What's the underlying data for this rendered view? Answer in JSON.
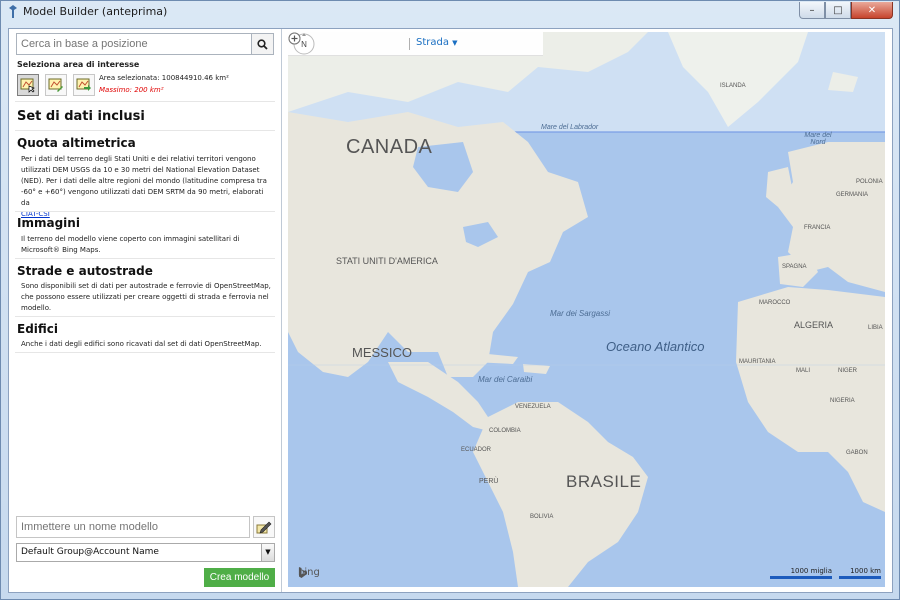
{
  "window": {
    "title": "Model Builder (anteprima)"
  },
  "search": {
    "placeholder": "Cerca in base a posizione"
  },
  "area_of_interest": {
    "label": "Seleziona area di interesse",
    "selected_area": "Area selezionata: 100844910.46 km²",
    "max_area": "Massimo: 200 km²"
  },
  "datasets": {
    "title": "Set di dati inclusi",
    "elevation": {
      "title": "Quota altimetrica",
      "body": "Per i dati del terreno degli Stati Uniti e dei relativi territori vengono utilizzati DEM USGS da 10 e 30 metri del National Elevation Dataset (NED). Per i dati delle altre regioni del mondo (latitudine compresa tra -60° e +60°) vengono utilizzati dati DEM SRTM da 90 metri, elaborati da",
      "link": "CIAT-CSI"
    },
    "imagery": {
      "title": "Immagini",
      "body": "Il terreno del modello viene coperto con immagini satellitari di Microsoft® Bing Maps."
    },
    "roads": {
      "title": "Strade e autostrade",
      "body": "Sono disponibili set di dati per autostrade e ferrovie di OpenStreetMap, che possono essere utilizzati per creare oggetti di strada e ferrovia nel modello."
    },
    "buildings": {
      "title": "Edifici",
      "body": "Anche i dati degli edifici sono ricavati dal set di dati OpenStreetMap."
    }
  },
  "model": {
    "name_placeholder": "Immettere un nome modello",
    "group_selected": "Default Group@Account Name",
    "create_label": "Crea modello"
  },
  "map": {
    "style_label": "Strada",
    "compass_label": "N",
    "brand": "bing",
    "scale_miles": "1000 miglia",
    "scale_km": "1000 km",
    "labels": {
      "canada": "CANADA",
      "usa": "STATI UNITI D'AMERICA",
      "mexico": "MESSICO",
      "brazil": "BRASILE",
      "atlantic": "Oceano Atlantico",
      "sargasso": "Mar dei Sargassi",
      "caribbean": "Mar dei Caraibi",
      "labrador": "Mare del Labrador",
      "north_sea": "Mare del Nord",
      "venezuela": "VENEZUELA",
      "colombia": "COLOMBIA",
      "ecuador": "ECUADOR",
      "peru": "PERÙ",
      "bolivia": "BOLIVIA",
      "algeria": "ALGERIA",
      "morocco": "MAROCCO",
      "mauritania": "MAURITANIA",
      "mali": "MALI",
      "niger": "NIGER",
      "nigeria": "NIGERIA",
      "libya": "LIBIA",
      "france": "FRANCIA",
      "spain": "SPAGNA",
      "germany": "GERMANIA",
      "poland": "POLONIA",
      "islanda": "ISLANDA",
      "gabon": "GABON"
    }
  }
}
